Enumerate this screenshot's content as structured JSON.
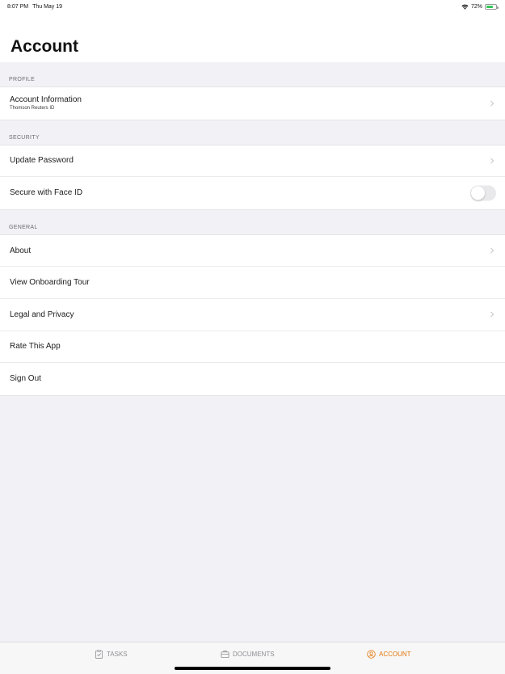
{
  "status_bar": {
    "time": "8:07 PM",
    "date": "Thu May 19",
    "battery_percent": "72%",
    "battery_level": 0.72,
    "icons": [
      "wifi-icon",
      "battery-icon"
    ]
  },
  "page": {
    "title": "Account"
  },
  "sections": {
    "profile": {
      "header": "PROFILE",
      "account_info": {
        "label": "Account Information",
        "sublabel": "Thomson Reuters ID"
      }
    },
    "security": {
      "header": "SECURITY",
      "update_password": {
        "label": "Update Password"
      },
      "face_id": {
        "label": "Secure with Face ID",
        "enabled": false
      }
    },
    "general": {
      "header": "GENERAL",
      "about": {
        "label": "About"
      },
      "onboarding": {
        "label": "View Onboarding Tour"
      },
      "legal": {
        "label": "Legal and Privacy"
      },
      "rate": {
        "label": "Rate This App"
      },
      "sign_out": {
        "label": "Sign Out"
      }
    }
  },
  "tab_bar": {
    "active_color": "#e4760b",
    "inactive_color": "#8e8e93",
    "tabs": [
      {
        "label": "TASKS",
        "icon": "clipboard-check-icon",
        "active": false
      },
      {
        "label": "DOCUMENTS",
        "icon": "briefcase-icon",
        "active": false
      },
      {
        "label": "ACCOUNT",
        "icon": "user-circle-icon",
        "active": true
      }
    ]
  }
}
